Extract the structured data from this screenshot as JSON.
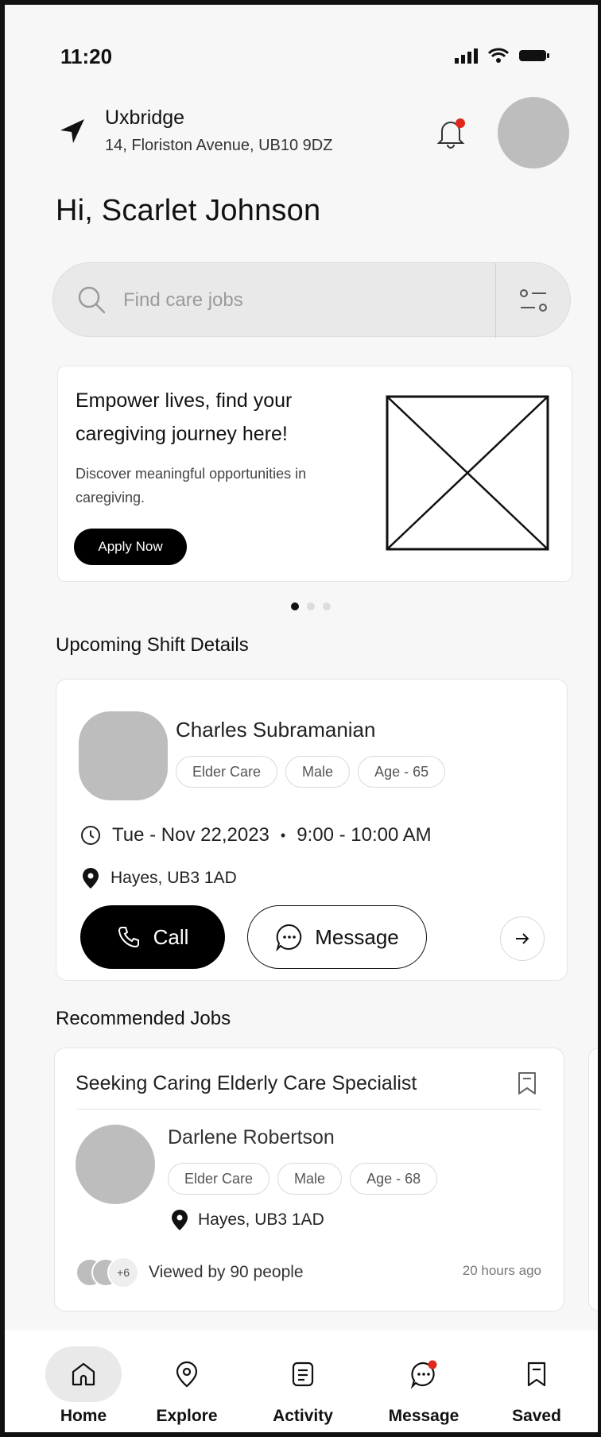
{
  "status_bar": {
    "time": "11:20"
  },
  "location": {
    "city": "Uxbridge",
    "address": "14, Floriston Avenue, UB10 9DZ"
  },
  "greeting": "Hi, Scarlet Johnson",
  "search": {
    "placeholder": "Find care jobs"
  },
  "banner": {
    "title": "Empower lives, find your caregiving journey here!",
    "subtitle": "Discover meaningful opportunities in caregiving.",
    "cta_label": "Apply Now"
  },
  "carousel": {
    "count": 3,
    "active": 0
  },
  "upcoming": {
    "section_title": "Upcoming Shift Details",
    "name": "Charles Subramanian",
    "tags": [
      "Elder Care",
      "Male",
      "Age - 65"
    ],
    "date": "Tue - Nov 22,2023",
    "time": "9:00 - 10:00 AM",
    "location": "Hayes, UB3 1AD",
    "call_label": "Call",
    "message_label": "Message"
  },
  "recommended": {
    "section_title": "Recommended Jobs",
    "job_title": "Seeking Caring Elderly Care Specialist",
    "name": "Darlene Robertson",
    "tags": [
      "Elder Care",
      "Male",
      "Age - 68"
    ],
    "location": "Hayes, UB3 1AD",
    "extra_viewers": "+6",
    "viewed_text": "Viewed by 90 people",
    "posted": "20 hours ago"
  },
  "nav": {
    "items": [
      {
        "label": "Home",
        "icon": "home-icon",
        "active": true
      },
      {
        "label": "Explore",
        "icon": "location-pin-icon"
      },
      {
        "label": "Activity",
        "icon": "document-icon"
      },
      {
        "label": "Message",
        "icon": "chat-bubble-icon",
        "badge": true
      },
      {
        "label": "Saved",
        "icon": "bookmark-icon"
      }
    ]
  },
  "colors": {
    "accent": "#000000",
    "notification_dot": "#e0281e",
    "placeholder_grey": "#bdbdbd"
  }
}
